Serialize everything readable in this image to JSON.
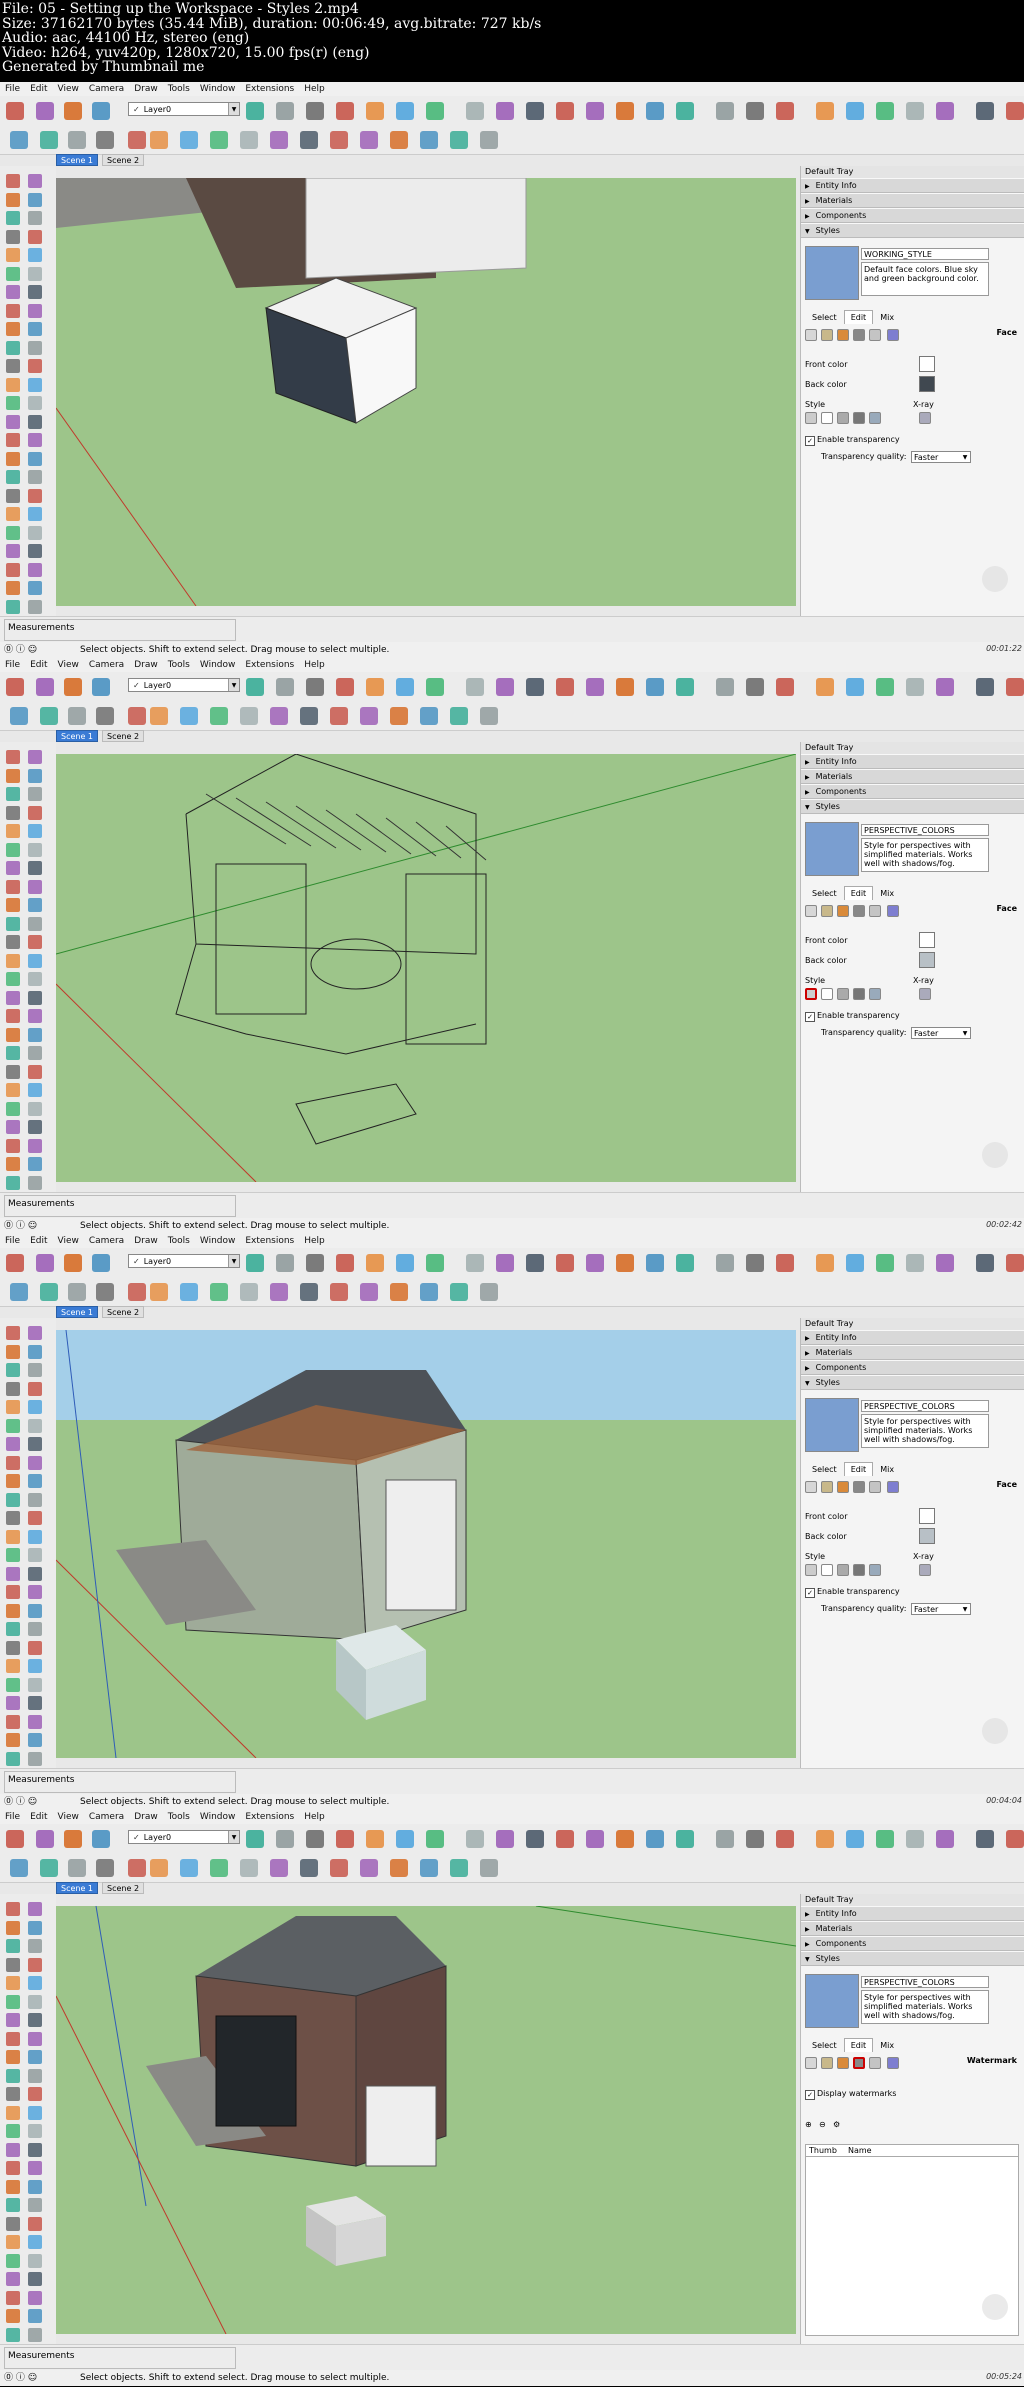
{
  "header": {
    "lines": [
      "File: 05 - Setting up the Workspace - Styles 2.mp4",
      "Size: 37162170 bytes (35.44 MiB), duration: 00:06:49, avg.bitrate: 727 kb/s",
      "Audio: aac, 44100 Hz, stereo (eng)",
      "Video: h264, yuv420p, 1280x720, 15.00 fps(r) (eng)",
      "Generated by Thumbnail me"
    ]
  },
  "menu": [
    "File",
    "Edit",
    "View",
    "Camera",
    "Draw",
    "Tools",
    "Window",
    "Extensions",
    "Help"
  ],
  "layer": "Layer0",
  "scenes": [
    "Scene 1",
    "Scene 2"
  ],
  "tray": {
    "title": "Default Tray",
    "panels": [
      "Entity Info",
      "Materials",
      "Components",
      "Styles"
    ]
  },
  "styles_tabs": [
    "Select",
    "Edit",
    "Mix"
  ],
  "measurements_label": "Measurements",
  "status_text": "Select objects. Shift to extend select. Drag mouse to select multiple.",
  "frames": [
    {
      "style_name": "WORKING_STYLE",
      "style_desc": "Default face colors. Blue sky and green background color.",
      "section": "Face",
      "front_color": "Front color",
      "back_color": "Back color",
      "style_label": "Style",
      "xray_label": "X-ray",
      "transparency_label": "Enable transparency",
      "quality_label": "Transparency quality:",
      "quality_value": "Faster",
      "timestamp": "00:01:22"
    },
    {
      "style_name": "PERSPECTIVE_COLORS",
      "style_desc": "Style for perspectives with simplified materials. Works well with shadows/fog.",
      "section": "Face",
      "front_color": "Front color",
      "back_color": "Back color",
      "style_label": "Style",
      "xray_label": "X-ray",
      "transparency_label": "Enable transparency",
      "quality_label": "Transparency quality:",
      "quality_value": "Faster",
      "timestamp": "00:02:42"
    },
    {
      "style_name": "PERSPECTIVE_COLORS",
      "style_desc": "Style for perspectives with simplified materials. Works well with shadows/fog.",
      "section": "Face",
      "front_color": "Front color",
      "back_color": "Back color",
      "style_label": "Style",
      "xray_label": "X-ray",
      "transparency_label": "Enable transparency",
      "quality_label": "Transparency quality:",
      "quality_value": "Faster",
      "timestamp": "00:04:04"
    },
    {
      "style_name": "PERSPECTIVE_COLORS",
      "style_desc": "Style for perspectives with simplified materials. Works well with shadows/fog.",
      "section": "Watermark",
      "display_watermarks": "Display watermarks",
      "col_thumb": "Thumb",
      "col_name": "Name",
      "timestamp": "00:05:24"
    }
  ]
}
